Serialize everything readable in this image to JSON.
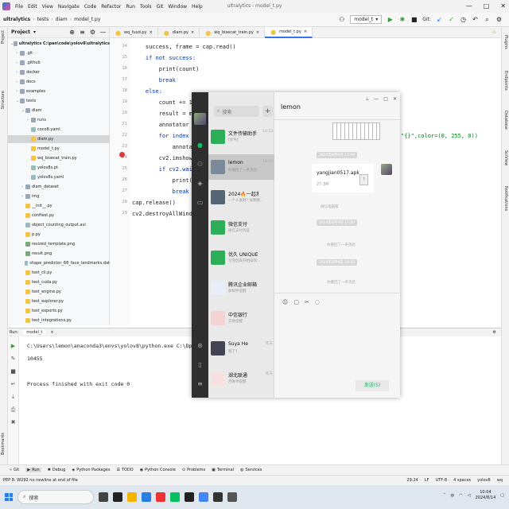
{
  "window": {
    "title": "ultralytics - model_t.py",
    "controls": [
      "—",
      "□",
      "✕"
    ]
  },
  "menu": [
    "File",
    "Edit",
    "View",
    "Navigate",
    "Code",
    "Refactor",
    "Run",
    "Tools",
    "Git",
    "Window",
    "Help"
  ],
  "breadcrumb": [
    "ultralytics",
    "tests",
    "diam",
    "model_t.py"
  ],
  "run_config": {
    "label": "model_t",
    "git_label": "Git:"
  },
  "left_tool_windows": [
    "Project",
    "Structure",
    "Bookmarks"
  ],
  "right_tool_windows": [
    "Plugins",
    "Endpoints",
    "Database",
    "SciView",
    "Notifications"
  ],
  "project": {
    "header": "Project",
    "tree": [
      {
        "indent": 0,
        "label": "ultralytics  C:\\pan\\code\\yolov8\\ultralytics",
        "type": "folder",
        "open": true
      },
      {
        "indent": 1,
        "label": ".git",
        "type": "folder",
        "open": false
      },
      {
        "indent": 1,
        "label": ".github",
        "type": "folder",
        "open": false
      },
      {
        "indent": 1,
        "label": "docker",
        "type": "folder",
        "open": false
      },
      {
        "indent": 1,
        "label": "docs",
        "type": "folder",
        "open": false
      },
      {
        "indent": 1,
        "label": "examples",
        "type": "folder",
        "open": false
      },
      {
        "indent": 1,
        "label": "tests",
        "type": "folder",
        "open": true
      },
      {
        "indent": 2,
        "label": "diam",
        "type": "folder",
        "open": true
      },
      {
        "indent": 3,
        "label": "runs",
        "type": "folder",
        "open": false
      },
      {
        "indent": 3,
        "label": "coco8.yaml",
        "type": "txt"
      },
      {
        "indent": 3,
        "label": "diam.py",
        "type": "py",
        "selected": true
      },
      {
        "indent": 3,
        "label": "model_t.py",
        "type": "py"
      },
      {
        "indent": 3,
        "label": "wq_bisecat_train.py",
        "type": "py"
      },
      {
        "indent": 3,
        "label": "yolov8s.pt",
        "type": "txt"
      },
      {
        "indent": 3,
        "label": "yolov8s.yaml",
        "type": "txt"
      },
      {
        "indent": 2,
        "label": "diam_dataset",
        "type": "folder",
        "open": false
      },
      {
        "indent": 2,
        "label": "img",
        "type": "folder",
        "open": false
      },
      {
        "indent": 2,
        "label": "__init__.py",
        "type": "py"
      },
      {
        "indent": 2,
        "label": "conftest.py",
        "type": "py"
      },
      {
        "indent": 2,
        "label": "object_counting_output.avi",
        "type": "txt"
      },
      {
        "indent": 2,
        "label": "p.py",
        "type": "py"
      },
      {
        "indent": 2,
        "label": "resized_template.png",
        "type": "img"
      },
      {
        "indent": 2,
        "label": "result.png",
        "type": "img"
      },
      {
        "indent": 2,
        "label": "shape_predictor_68_face_landmarks.dat",
        "type": "txt"
      },
      {
        "indent": 2,
        "label": "test_cli.py",
        "type": "py"
      },
      {
        "indent": 2,
        "label": "test_cuda.py",
        "type": "py"
      },
      {
        "indent": 2,
        "label": "test_engine.py",
        "type": "py"
      },
      {
        "indent": 2,
        "label": "test_explorer.py",
        "type": "py"
      },
      {
        "indent": 2,
        "label": "test_exports.py",
        "type": "py"
      },
      {
        "indent": 2,
        "label": "test_integrations.py",
        "type": "py"
      }
    ]
  },
  "editor": {
    "tabs": [
      {
        "label": "wq_fuxd.py",
        "active": false
      },
      {
        "label": "diam.py",
        "active": false
      },
      {
        "label": "wq_bisecat_train.py",
        "active": false
      },
      {
        "label": "model_t.py",
        "active": true
      }
    ],
    "line_numbers": [
      "14",
      "15",
      "16",
      "17",
      "18",
      "19",
      "20",
      "21",
      "22",
      "23",
      "24",
      "25",
      "26",
      "27",
      "28",
      "29"
    ],
    "lines": [
      "    success, frame = cap.read()",
      "    if not success:",
      "        print(count)",
      "        break",
      "    else:",
      "        count += 1",
      "        result = model",
      "        annotator = An",
      "        for index in r",
      "            annotato",
      "        cv2.imshow( wi",
      "        if cv2.waitKey",
      "            print(coun",
      "            break",
      "cap.release()",
      "cv2.destroyAllWindows()"
    ],
    "line22_tail": "\"{}\",color=(0, 255, 0))"
  },
  "run": {
    "header": "Run:",
    "tab": "model_t",
    "console": [
      "C:\\Users\\lemon\\anaconda3\\envs\\yolov8\\python.exe C:\\Dpan\\cod",
      "10455",
      "",
      "Process finished with exit code 0"
    ]
  },
  "tool_tabs": [
    "Git",
    "Run",
    "Debug",
    "Python Packages",
    "TODO",
    "Python Console",
    "Problems",
    "Terminal",
    "Services"
  ],
  "status": {
    "left": "PEP 8: W292 no newline at end of file",
    "right": [
      "29:24",
      "LF",
      "UTF-8",
      "4 spaces",
      "yolov8",
      "wq"
    ]
  },
  "taskbar": {
    "search_placeholder": "搜索",
    "time": "10:04",
    "date": "2024/8/14"
  },
  "wechat": {
    "search_placeholder": "搜索",
    "add": "+",
    "chats": [
      {
        "name": "文件传输助手",
        "time": "14:53",
        "preview": "[文件]",
        "color": "#2fae5a"
      },
      {
        "name": "lemon",
        "time": "14:42",
        "preview": "你撤回了一条消息",
        "color": "#7a8a9a",
        "selected": true
      },
      {
        "name": "2024🔥一起发财",
        "time": "",
        "preview": "一个人发财? 加我喔...",
        "color": "#556677"
      },
      {
        "name": "微信支付",
        "time": "",
        "preview": "微信支付凭证",
        "color": "#2fae5a"
      },
      {
        "name": "优久 UNIQUE C...",
        "time": "",
        "preview": "写完后就开始操作...",
        "color": "#2fae5a"
      },
      {
        "name": "腾讯企业邮箱",
        "time": "",
        "preview": "新邮件提醒",
        "color": "#e8eef8"
      },
      {
        "name": "中信银行",
        "time": "",
        "preview": "交易提醒",
        "color": "#f3d3d3"
      },
      {
        "name": "Suya He",
        "time": "昨天",
        "preview": "嗯了?",
        "color": "#445"
      },
      {
        "name": "湖北联通",
        "time": "昨天",
        "preview": "月账单提醒",
        "color": "#f6e0e0"
      }
    ],
    "chat": {
      "title": "lemon",
      "controls": [
        "⊥",
        "—",
        "□",
        "✕"
      ],
      "timestamps": [
        "2024年8月9日 17:09",
        "2024年8月9日 17:10",
        "2024年8月9日 18:35"
      ],
      "file": {
        "name": "yangjian0517.apk",
        "size": "27.3M",
        "status": "微信电脑版",
        "icon": "?"
      },
      "recalled": [
        "你撤回了一条消息",
        "你撤回了一条消息"
      ],
      "toolbar": [
        "☺",
        "▢",
        "✂",
        "◌"
      ],
      "send": "发送(S)"
    }
  }
}
